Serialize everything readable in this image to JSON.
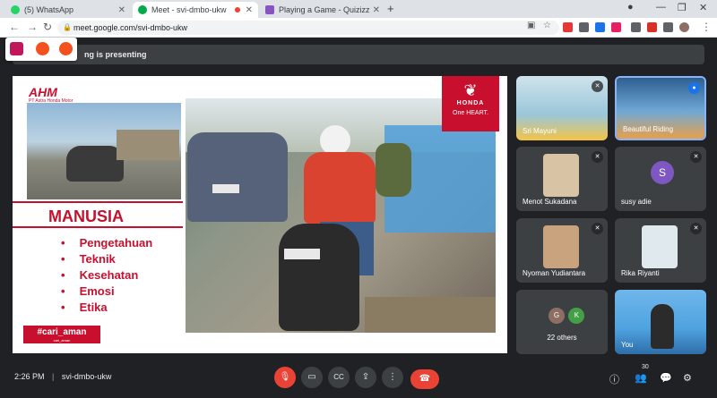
{
  "browser": {
    "tabs": [
      {
        "title": "(5) WhatsApp",
        "color": "#25d366"
      },
      {
        "title": "Meet - svi-dmbo-ukw",
        "color": "#00ac47"
      },
      {
        "title": "Playing a Game - Quizizz",
        "color": "#8854c0"
      }
    ],
    "url": "meet.google.com/svi-dmbo-ukw"
  },
  "meet": {
    "presenting_text": "ng is presenting",
    "time": "2:26 PM",
    "separator": "|",
    "meeting_code": "svi-dmbo-ukw",
    "participant_count": "30"
  },
  "slide": {
    "logo": "AHM",
    "logo_sub": "PT Astra Honda Motor",
    "heading": "MANUSIA",
    "items": [
      "Pengetahuan",
      "Teknik",
      "Kesehatan",
      "Emosi",
      "Etika"
    ],
    "tag": "#cari_aman",
    "tag_sub": "cari_aman",
    "brand": "HONDA",
    "brand_tagline": "One HEART."
  },
  "participants": [
    {
      "name": "Sri Mayuni",
      "type": "video",
      "color": "#9bc6d9"
    },
    {
      "name": "Beautiful Riding",
      "type": "video",
      "color": "#6fa8d6"
    },
    {
      "name": "Menot Sukadana",
      "type": "video",
      "color": "#d8c3a5"
    },
    {
      "name": "susy adie",
      "type": "avatar",
      "initial": "S",
      "color": "#7e57c2"
    },
    {
      "name": "Nyoman Yudiantara",
      "type": "video",
      "color": "#c9a27e"
    },
    {
      "name": "Rika Riyanti",
      "type": "video",
      "color": "#dfe9ee"
    },
    {
      "name": "22 others",
      "type": "others",
      "initials": [
        "G",
        "K"
      ],
      "colors": [
        "#8d6e63",
        "#43a047"
      ]
    },
    {
      "name": "You",
      "type": "video",
      "color": "#4fa3e0"
    }
  ]
}
